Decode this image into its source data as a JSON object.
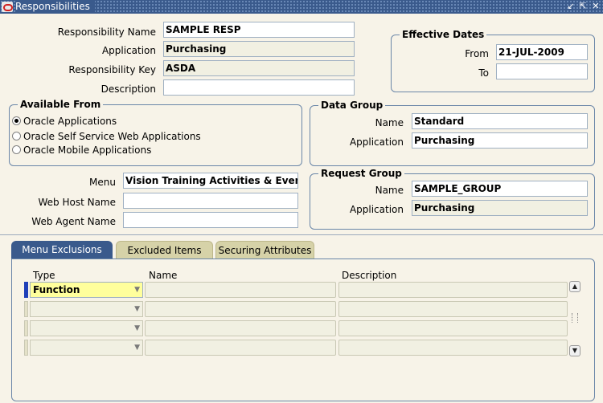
{
  "window": {
    "title": "Responsibilities",
    "controls": {
      "minimize": "↙",
      "maximize": "⇱",
      "close": "✕"
    }
  },
  "form": {
    "responsibility_name": {
      "label": "Responsibility Name",
      "value": "SAMPLE RESP"
    },
    "application": {
      "label": "Application",
      "value": "Purchasing"
    },
    "responsibility_key": {
      "label": "Responsibility Key",
      "value": "ASDA"
    },
    "description": {
      "label": "Description",
      "value": ""
    }
  },
  "effective_dates": {
    "title": "Effective Dates",
    "from": {
      "label": "From",
      "value": "21-JUL-2009"
    },
    "to": {
      "label": "To",
      "value": ""
    }
  },
  "available_from": {
    "title": "Available From",
    "options": [
      {
        "label": "Oracle Applications",
        "selected": true
      },
      {
        "label": "Oracle Self Service Web Applications",
        "selected": false
      },
      {
        "label": "Oracle Mobile Applications",
        "selected": false
      }
    ]
  },
  "data_group": {
    "title": "Data Group",
    "name": {
      "label": "Name",
      "value": "Standard"
    },
    "application": {
      "label": "Application",
      "value": "Purchasing"
    }
  },
  "menu_section": {
    "menu": {
      "label": "Menu",
      "value": "Vision Training Activities & Events"
    },
    "web_host_name": {
      "label": "Web Host Name",
      "value": ""
    },
    "web_agent_name": {
      "label": "Web Agent Name",
      "value": ""
    }
  },
  "request_group": {
    "title": "Request Group",
    "name": {
      "label": "Name",
      "value": "SAMPLE_GROUP"
    },
    "application": {
      "label": "Application",
      "value": "Purchasing"
    }
  },
  "tabs": [
    {
      "label": "Menu Exclusions",
      "active": true
    },
    {
      "label": "Excluded Items",
      "active": false
    },
    {
      "label": "Securing Attributes",
      "active": false
    }
  ],
  "exclusions_table": {
    "columns": [
      "Type",
      "Name",
      "Description"
    ],
    "rows": [
      {
        "type": "Function",
        "name": "",
        "description": ""
      },
      {
        "type": "",
        "name": "",
        "description": ""
      },
      {
        "type": "",
        "name": "",
        "description": ""
      },
      {
        "type": "",
        "name": "",
        "description": ""
      }
    ]
  },
  "colors": {
    "titlebar": "#3a5a8c",
    "background": "#f7f3e8",
    "active_cell": "#ffff9c",
    "active_tab": "#3a5a8c",
    "inactive_tab": "#d6d2a8"
  }
}
